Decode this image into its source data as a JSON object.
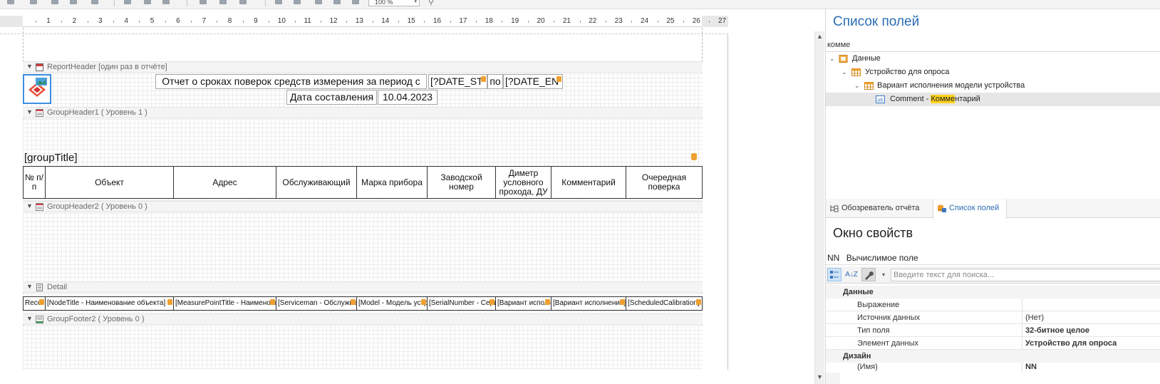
{
  "toolbar": {
    "zoom_value": "100 %",
    "zoom_arrow": "▾",
    "zoom_icon": "⚲"
  },
  "ruler": {
    "numbers": [
      "1",
      "2",
      "3",
      "4",
      "5",
      "6",
      "7",
      "8",
      "9",
      "10",
      "11",
      "12",
      "13",
      "14",
      "15",
      "16",
      "17",
      "18",
      "19",
      "20",
      "21",
      "22",
      "23",
      "24",
      "25",
      "26",
      "27"
    ]
  },
  "bands": {
    "report_header": "ReportHeader [один раз в отчёте]",
    "group_header1": "GroupHeader1 ( Уровень 1 )",
    "group_header2": "GroupHeader2 ( Уровень 0 )",
    "detail": "Detail",
    "group_footer2": "GroupFooter2 ( Уровень 0 )"
  },
  "report": {
    "title_text": "Отчет о сроках поверок средств измерения за период с",
    "date_start": "[?DATE_ST",
    "po": "по",
    "date_end": "[?DATE_EN",
    "compiled_label": "Дата составления",
    "compiled_date": "10.04.2023",
    "group_title": "[groupTitle]"
  },
  "table": {
    "headers": [
      "№ п/п",
      "Объект",
      "Адрес",
      "Обслуживающий",
      "Марка прибора",
      "Заводской номер",
      "Диметр условного прохода, ДУ",
      "Комментарий",
      "Очередная поверка"
    ],
    "detail_cells": [
      "Reco",
      "[NodeTitle - Наименование объекта]",
      "[MeasurePointTitle - Наименование]",
      "[Serviceman - Обслуживающий]",
      "[Model - Модель устройства]",
      "[SerialNumber - Серийный]",
      "[Вариант исполнения]",
      "[Вариант исполнения]",
      "[ScheduledCalibration]"
    ]
  },
  "field_list": {
    "title": "Список полей",
    "search_text": "комме",
    "tree": {
      "root": "Данные",
      "level1": "Устройство для опроса",
      "level2": "Вариант исполнения модели устройства",
      "leaf_prefix": "Comment - ",
      "leaf_highlight": "Комме",
      "leaf_suffix": "нтарий"
    }
  },
  "tabs": {
    "report_explorer": "Обозреватель отчёта",
    "field_list": "Список полей"
  },
  "properties": {
    "title": "Окно свойств",
    "selected_name": "NN",
    "selected_type": "Вычислимое поле",
    "search_placeholder": "Введите текст для поиска...",
    "sort_label": "A↓Z",
    "categories": {
      "data": "Данные",
      "design": "Дизайн"
    },
    "rows": [
      {
        "name": "Выражение",
        "value": ""
      },
      {
        "name": "Источник данных",
        "value": "(Нет)"
      },
      {
        "name": "Тип поля",
        "value": "32-битное целое"
      },
      {
        "name": "Элемент данных",
        "value": "Устройство для опроса"
      }
    ],
    "design_row_name": "(Имя)",
    "design_row_value": "NN"
  },
  "colors": {
    "accent": "#2b6cb3",
    "highlight": "#ffd21e",
    "marker": "#f0a030"
  }
}
